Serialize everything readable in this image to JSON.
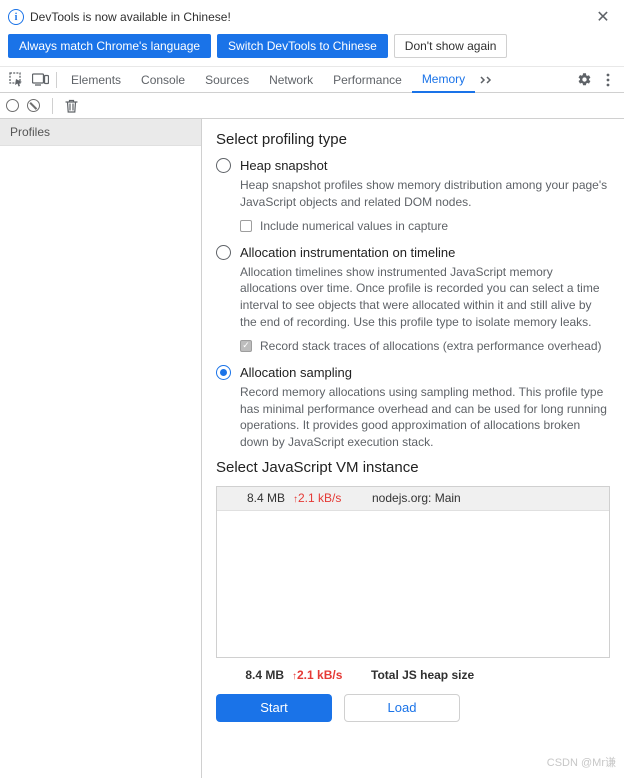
{
  "banner": {
    "text": "DevTools is now available in Chinese!",
    "match_btn": "Always match Chrome's language",
    "switch_btn": "Switch DevTools to Chinese",
    "dismiss_btn": "Don't show again"
  },
  "tabs": {
    "items": [
      "Elements",
      "Console",
      "Sources",
      "Network",
      "Performance",
      "Memory"
    ],
    "active_index": 5
  },
  "sidebar": {
    "profiles_label": "Profiles"
  },
  "profiling": {
    "heading": "Select profiling type",
    "options": [
      {
        "label": "Heap snapshot",
        "desc": "Heap snapshot profiles show memory distribution among your page's JavaScript objects and related DOM nodes.",
        "sub_checkbox": {
          "label": "Include numerical values in capture",
          "checked": false
        }
      },
      {
        "label": "Allocation instrumentation on timeline",
        "desc": "Allocation timelines show instrumented JavaScript memory allocations over time. Once profile is recorded you can select a time interval to see objects that were allocated within it and still alive by the end of recording. Use this profile type to isolate memory leaks.",
        "sub_checkbox": {
          "label": "Record stack traces of allocations (extra performance overhead)",
          "checked": true
        }
      },
      {
        "label": "Allocation sampling",
        "desc": "Record memory allocations using sampling method. This profile type has minimal performance overhead and can be used for long running operations. It provides good approximation of allocations broken down by JavaScript execution stack."
      }
    ],
    "selected_index": 2
  },
  "vm": {
    "heading": "Select JavaScript VM instance",
    "row": {
      "size": "8.4 MB",
      "rate": "2.1 kB/s",
      "name": "nodejs.org: Main"
    },
    "total": {
      "size": "8.4 MB",
      "rate": "2.1 kB/s",
      "label": "Total JS heap size"
    }
  },
  "actions": {
    "start": "Start",
    "load": "Load"
  },
  "watermark": "CSDN @Mr谦"
}
